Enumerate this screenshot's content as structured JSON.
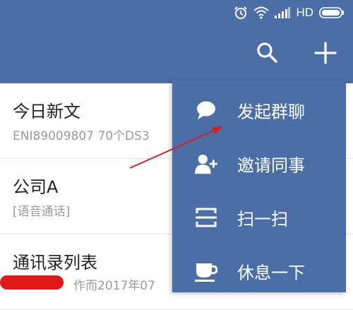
{
  "status_bar": {
    "network_label": "HD",
    "icons": [
      "alarm-icon",
      "wifi-icon",
      "signal-icon",
      "battery-icon"
    ]
  },
  "app_bar": {
    "actions": [
      "search-icon",
      "plus-icon"
    ],
    "color": "#4a6ea5"
  },
  "chats": [
    {
      "title": "今日新文",
      "subtitle": "ENI89009807 70个DS3"
    },
    {
      "title": "公司A",
      "subtitle": "[语音通话]"
    },
    {
      "title": "通讯录列表",
      "subtitle": "作而2017年07"
    }
  ],
  "popup_menu": {
    "items": [
      {
        "label": "发起群聊",
        "icon": "chat-bubble-icon"
      },
      {
        "label": "邀请同事",
        "icon": "add-person-icon"
      },
      {
        "label": "扫一扫",
        "icon": "scan-icon"
      },
      {
        "label": "休息一下",
        "icon": "coffee-cup-icon"
      }
    ]
  },
  "annotation": {
    "color": "#d42020"
  }
}
